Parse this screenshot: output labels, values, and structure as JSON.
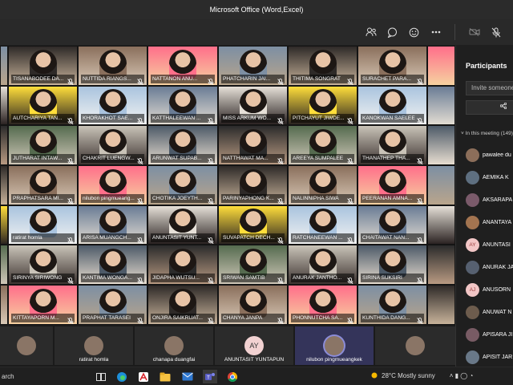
{
  "window": {
    "title": "Microsoft Office (Word,Excel)"
  },
  "colors": {
    "accent": "#6264a7",
    "bg": "#1f1f1f",
    "tile_name_bg": "rgba(0,0,0,0.55)"
  },
  "toolbar": {
    "icons": [
      "people-icon",
      "chat-icon",
      "reactions-icon",
      "more-icon",
      "camera-off-icon",
      "mic-off-icon"
    ]
  },
  "grid": {
    "tiles": [
      [
        "",
        "TISANABODEE DA...",
        "NUTTIDA RIANGS...",
        "NATTANON ANU...",
        "PHATCHARIN JAI...",
        "THITIMA SONGRAT",
        "SURACHET PARA...",
        ""
      ],
      [
        "",
        "AUTCHARIYA TAN...",
        "KHORAKHOT SAE...",
        "KATTHALEEWAN ...",
        "MISS ARKUM WO...",
        "PITCHAYUT JIWDE...",
        "KANOKWAN SAELEE",
        ""
      ],
      [
        "",
        "JUTHARAT INTAW...",
        "CHAKRIT LUENGW...",
        "ARUNWAT SUPAB...",
        "NATTHAWAT MA...",
        "AREEYA SUMPALEE",
        "THANATHEP THA...",
        ""
      ],
      [
        "",
        "PRAPHATSARA MI...",
        "nilubon pingmueang...",
        "CHOTIKA JOEYTH...",
        "PARINYAPHONG K...",
        "NALINNIPHA SIWA",
        "PEERANAN AMNA...",
        ""
      ],
      [
        "",
        "ratirat homla",
        "ARISA MUANGCH...",
        "ANUNTASIT YUNT...",
        "SUVAPATCH DECH...",
        "RATCHANEEWAN ...",
        "CHAITAWAT NAN...",
        ""
      ],
      [
        "",
        "SIRINYA SIRIWONG",
        "KANTIMA WONGA...",
        "JIDAPHA WUTSU...",
        "SRIWAN SAMTIB",
        "ANURAK JANTHO...",
        "SIRINA SUKSIRI",
        ""
      ],
      [
        "",
        "KITTAYAPORN M...",
        "PRAPHAT TARASEI",
        "ONJIRA SAIKRUAT...",
        "CHANYA JANPA",
        "PHONNUTCHA SA...",
        "KUNTHIDA DANG...",
        ""
      ]
    ]
  },
  "participants_panel": {
    "title": "Participants",
    "invite_placeholder": "Invite someone",
    "share_icon": "share-icon",
    "section_label": "In this meeting (149)",
    "people": [
      {
        "name": "pawalee du",
        "initials": ""
      },
      {
        "name": "AEMIKA K",
        "initials": ""
      },
      {
        "name": "AKSARAPA",
        "initials": ""
      },
      {
        "name": "ANANTAYA",
        "initials": ""
      },
      {
        "name": "ANUNTASI",
        "initials": "AY"
      },
      {
        "name": "ANURAK JA",
        "initials": ""
      },
      {
        "name": "ANUSORN",
        "initials": "AJ"
      },
      {
        "name": "ANUWAT N",
        "initials": ""
      },
      {
        "name": "APISARA JI",
        "initials": ""
      },
      {
        "name": "APISIT JAR",
        "initials": ""
      }
    ]
  },
  "bottom_row": [
    {
      "name": "",
      "initials": ""
    },
    {
      "name": "ratirat homla",
      "initials": ""
    },
    {
      "name": "chanapa duangfai",
      "initials": ""
    },
    {
      "name": "ANUNTASIT YUNTAPUN",
      "initials": "AY"
    },
    {
      "name": "nilubon pingmueangkek",
      "initials": ""
    },
    {
      "name": "",
      "initials": ""
    }
  ],
  "taskbar": {
    "search_label": "arch",
    "weather": "28°C  Mostly sunny"
  }
}
